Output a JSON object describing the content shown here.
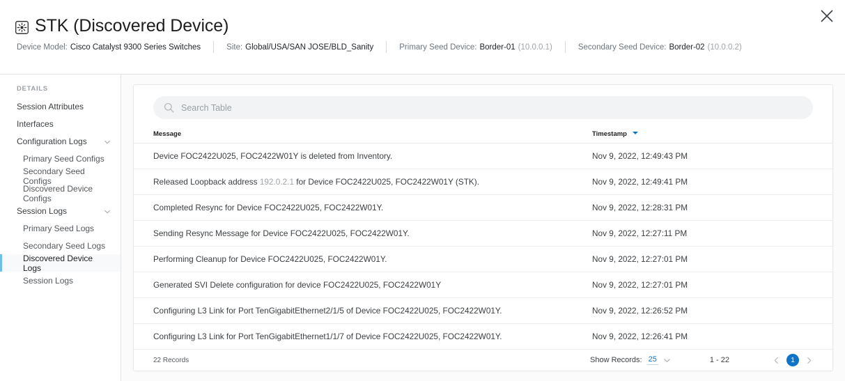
{
  "header": {
    "title": "STK (Discovered Device)",
    "title_icon": "stack-device-icon",
    "close_icon": "close-icon",
    "meta": [
      {
        "label": "Device Model:",
        "value": "Cisco Catalyst 9300 Series Switches",
        "sub": ""
      },
      {
        "label": "Site:",
        "value": "Global/USA/SAN JOSE/BLD_Sanity",
        "sub": ""
      },
      {
        "label": "Primary Seed Device:",
        "value": "Border-01",
        "sub": "(10.0.0.1)"
      },
      {
        "label": "Secondary Seed Device:",
        "value": "Border-02",
        "sub": "(10.0.0.2)"
      }
    ]
  },
  "sidebar": {
    "heading": "DETAILS",
    "items": [
      {
        "label": "Session Attributes",
        "level": 0,
        "chevron": false,
        "active": false
      },
      {
        "label": "Interfaces",
        "level": 0,
        "chevron": false,
        "active": false
      },
      {
        "label": "Configuration Logs",
        "level": 0,
        "chevron": true,
        "active": false
      },
      {
        "label": "Primary Seed Configs",
        "level": 1,
        "chevron": false,
        "active": false
      },
      {
        "label": "Secondary Seed Configs",
        "level": 1,
        "chevron": false,
        "active": false
      },
      {
        "label": "Discovered Device Configs",
        "level": 1,
        "chevron": false,
        "active": false
      },
      {
        "label": "Session Logs",
        "level": 0,
        "chevron": true,
        "active": false
      },
      {
        "label": "Primary Seed Logs",
        "level": 1,
        "chevron": false,
        "active": false
      },
      {
        "label": "Secondary Seed Logs",
        "level": 1,
        "chevron": false,
        "active": false
      },
      {
        "label": "Discovered Device Logs",
        "level": 1,
        "chevron": false,
        "active": true
      },
      {
        "label": "Session Logs",
        "level": 1,
        "chevron": false,
        "active": false
      }
    ]
  },
  "search": {
    "placeholder": "Search Table",
    "value": "",
    "icon": "search-icon"
  },
  "table": {
    "columns": [
      {
        "key": "message",
        "label": "Message",
        "sorted": false
      },
      {
        "key": "timestamp",
        "label": "Timestamp",
        "sorted": true,
        "sort_dir": "desc"
      }
    ],
    "rows": [
      {
        "message": "Device FOC2422U025, FOC2422W01Y is deleted from Inventory.",
        "message_pre": "",
        "ip": "",
        "message_post": "",
        "timestamp": "Nov 9, 2022, 12:49:43 PM"
      },
      {
        "message": "",
        "message_pre": "Released Loopback address",
        "ip": "192.0.2.1",
        "message_post": "for Device FOC2422U025, FOC2422W01Y (STK).",
        "timestamp": "Nov 9, 2022, 12:49:41 PM"
      },
      {
        "message": "Completed Resync for Device FOC2422U025, FOC2422W01Y.",
        "message_pre": "",
        "ip": "",
        "message_post": "",
        "timestamp": "Nov 9, 2022, 12:28:31 PM"
      },
      {
        "message": "Sending Resync Message for Device FOC2422U025, FOC2422W01Y.",
        "message_pre": "",
        "ip": "",
        "message_post": "",
        "timestamp": "Nov 9, 2022, 12:27:11 PM"
      },
      {
        "message": "Performing Cleanup for Device FOC2422U025, FOC2422W01Y.",
        "message_pre": "",
        "ip": "",
        "message_post": "",
        "timestamp": "Nov 9, 2022, 12:27:01 PM"
      },
      {
        "message": "Generated SVI Delete configuration for device FOC2422U025, FOC2422W01Y",
        "message_pre": "",
        "ip": "",
        "message_post": "",
        "timestamp": "Nov 9, 2022, 12:27:01 PM"
      },
      {
        "message": "Configuring L3 Link for Port TenGigabitEthernet2/1/5 of Device FOC2422U025, FOC2422W01Y.",
        "message_pre": "",
        "ip": "",
        "message_post": "",
        "timestamp": "Nov 9, 2022, 12:26:52 PM"
      },
      {
        "message": "Configuring L3 Link for Port TenGigabitEthernet1/1/7 of Device FOC2422U025, FOC2422W01Y.",
        "message_pre": "",
        "ip": "",
        "message_post": "",
        "timestamp": "Nov 9, 2022, 12:26:41 PM"
      }
    ]
  },
  "footer": {
    "records_text": "22 Records",
    "show_records_label": "Show Records:",
    "show_records_value": "25",
    "range_text": "1 - 22",
    "page_prev_icon": "chevron-left-icon",
    "page_next_icon": "chevron-right-icon",
    "current_page": "1"
  },
  "colors": {
    "accent": "#0d74c8",
    "active_border": "#6ec1e4",
    "text": "#3c4043",
    "muted": "#9aa0a6"
  }
}
